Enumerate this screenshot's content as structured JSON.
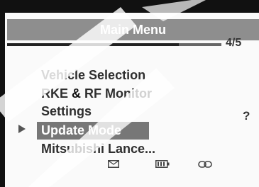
{
  "title": "Main Menu",
  "page_indicator": "4/5",
  "progress_fraction": 0.8,
  "menu": {
    "items": [
      {
        "label": "Vehicle Selection"
      },
      {
        "label_before": "RKE",
        "label_amp": "&",
        "label_after": "RF Monitor"
      },
      {
        "label": "Settings"
      },
      {
        "label": "Update Mode",
        "selected": true
      },
      {
        "label": "Mitsubishi Lance..."
      }
    ]
  },
  "help_label": "?",
  "status_icons": [
    "envelope-icon",
    "battery-icon",
    "link-icon"
  ]
}
